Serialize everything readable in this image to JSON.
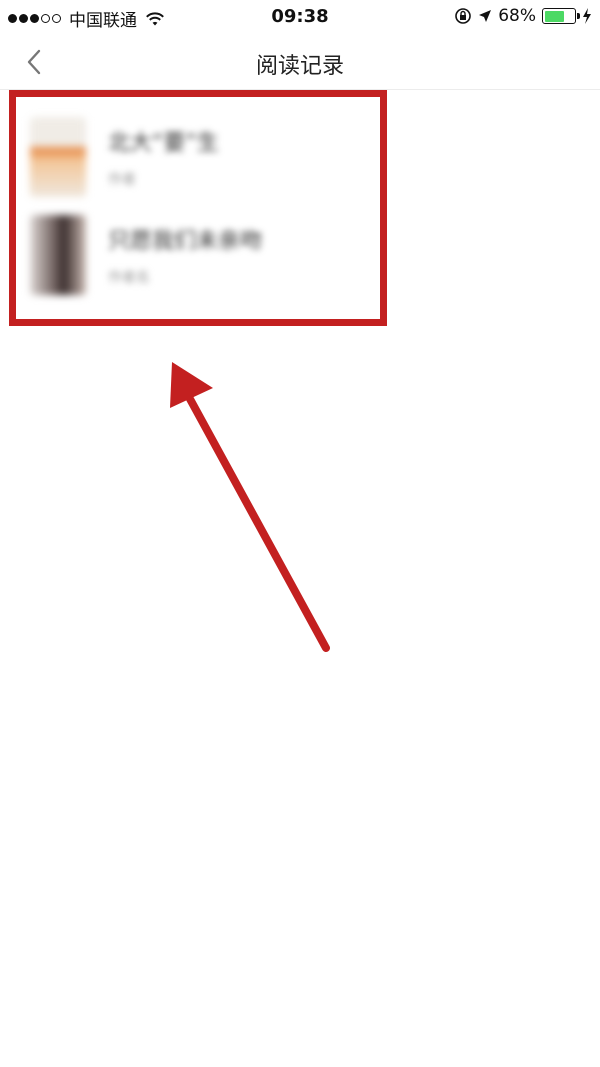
{
  "status_bar": {
    "carrier": "中国联通",
    "time": "09:38",
    "battery": "68%",
    "battery_level": 0.68,
    "battery_color": "#4cd964",
    "icons": [
      "signal-icon",
      "wifi-icon",
      "orientation-lock-icon",
      "location-icon",
      "battery-icon",
      "charging-icon"
    ]
  },
  "nav": {
    "title": "阅读记录",
    "back_icon": "chevron-left-icon"
  },
  "reading_history": [
    {
      "title": "北大“要”生",
      "subtitle": "作者"
    },
    {
      "title": "只愿我们未亲吻",
      "subtitle": "作者名"
    }
  ],
  "annotation": {
    "highlight_color": "#c32020",
    "arrow_color": "#c32020"
  }
}
